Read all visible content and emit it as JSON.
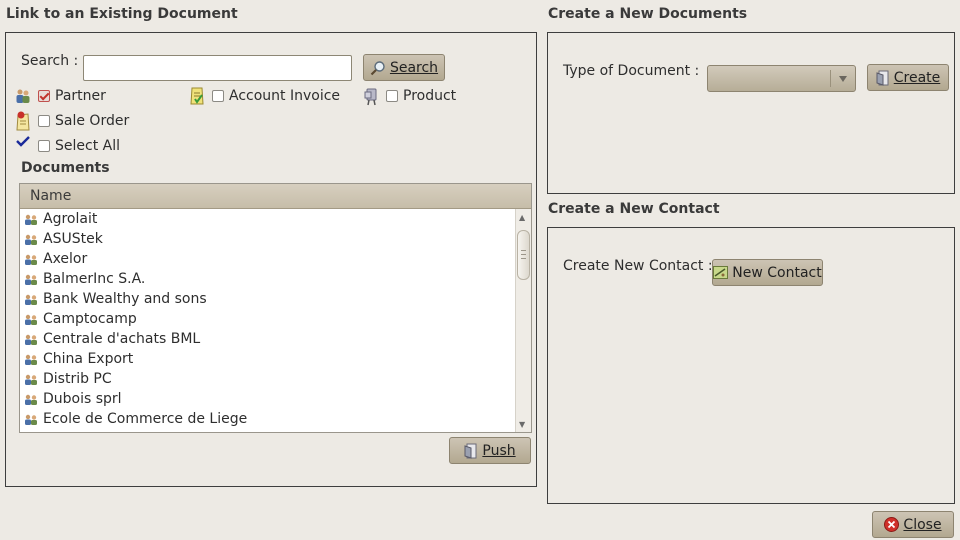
{
  "link_section": {
    "title": "Link to an Existing Document",
    "search_label": "Search :",
    "search_value": "",
    "search_button": "Search",
    "filters": [
      {
        "label": "Partner",
        "checked": true
      },
      {
        "label": "Account Invoice",
        "checked": false
      },
      {
        "label": "Product",
        "checked": false
      },
      {
        "label": "Sale Order",
        "checked": false
      },
      {
        "label": "Select All",
        "checked": false
      }
    ],
    "documents_title": "Documents",
    "column_header": "Name",
    "rows": [
      "Agrolait",
      "ASUStek",
      "Axelor",
      "BalmerInc S.A.",
      "Bank Wealthy and sons",
      "Camptocamp",
      "Centrale d'achats BML",
      "China Export",
      "Distrib PC",
      "Dubois sprl",
      "Ecole de Commerce de Liege"
    ],
    "push_button": "Push"
  },
  "create_doc_section": {
    "title": "Create a New Documents",
    "type_label": "Type of Document :",
    "type_value": "",
    "create_button": "Create"
  },
  "create_contact_section": {
    "title": "Create a New Contact",
    "label": "Create New Contact :",
    "button": "New Contact"
  },
  "close_button": "Close",
  "colors": {
    "background": "#edeae4",
    "button": "#b8ae98",
    "checked": "#c2342c"
  }
}
